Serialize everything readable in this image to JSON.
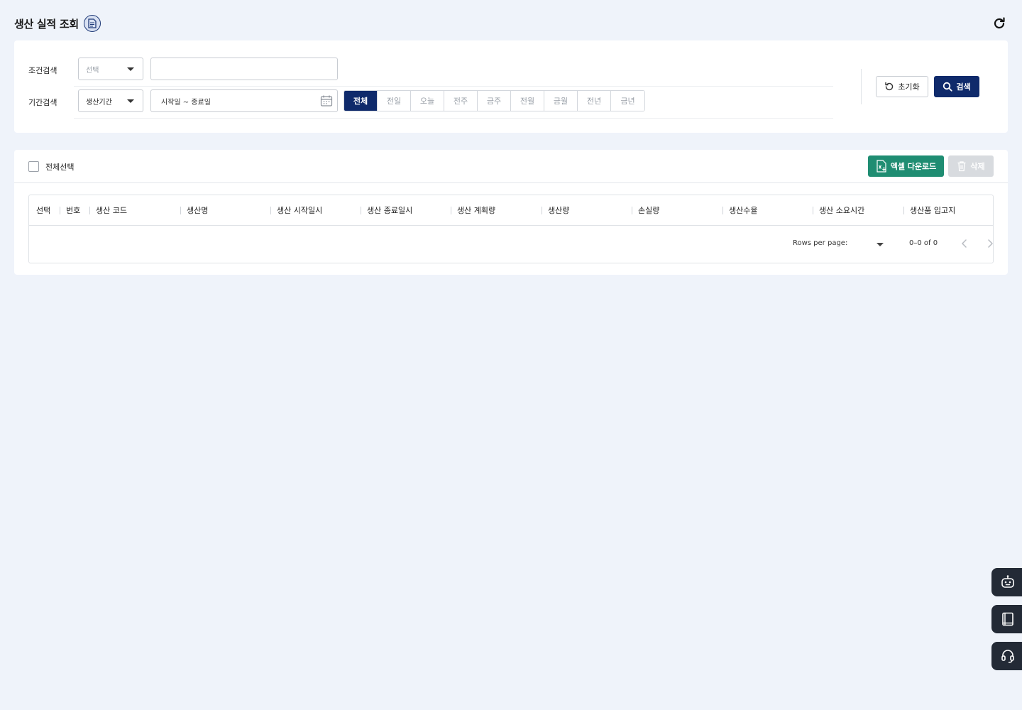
{
  "header": {
    "title": "생산 실적 조회"
  },
  "search": {
    "condition_label": "조건검색",
    "condition_select": "선택",
    "condition_input_value": "",
    "period_label": "기간검색",
    "period_select": "생산기간",
    "date_range_placeholder": "시작일 ~ 종료일",
    "period_buttons": [
      "전체",
      "전일",
      "오늘",
      "전주",
      "금주",
      "전월",
      "금월",
      "전년",
      "금년"
    ],
    "period_active": "전체",
    "reset_label": "초기화",
    "search_label": "검색"
  },
  "list": {
    "select_all_label": "전체선택",
    "excel_label": "엑셀 다운로드",
    "delete_label": "삭제",
    "columns": [
      "선택",
      "번호",
      "생산 코드",
      "생산명",
      "생산 시작일시",
      "생산 종료일시",
      "생산 계획량",
      "생산량",
      "손실량",
      "생산수율",
      "생산 소요시간",
      "생산품 입고지"
    ],
    "rows": [],
    "pager": {
      "rows_per_page_label": "Rows per page:",
      "rows_per_page_value": "",
      "range_text": "0–0 of 0"
    }
  },
  "colors": {
    "primary": "#0f2a6b",
    "excel": "#1f8d72",
    "background": "#eff3fa",
    "float_button": "#232a36"
  },
  "icons": {
    "title_icon": "document-icon",
    "refresh": "refresh-icon",
    "calendar": "calendar-icon",
    "reset": "reset-icon",
    "search": "search-icon",
    "excel": "excel-download-icon",
    "delete": "trash-icon",
    "float": [
      "chatbot-icon",
      "manual-book-icon",
      "headset-support-icon"
    ]
  }
}
